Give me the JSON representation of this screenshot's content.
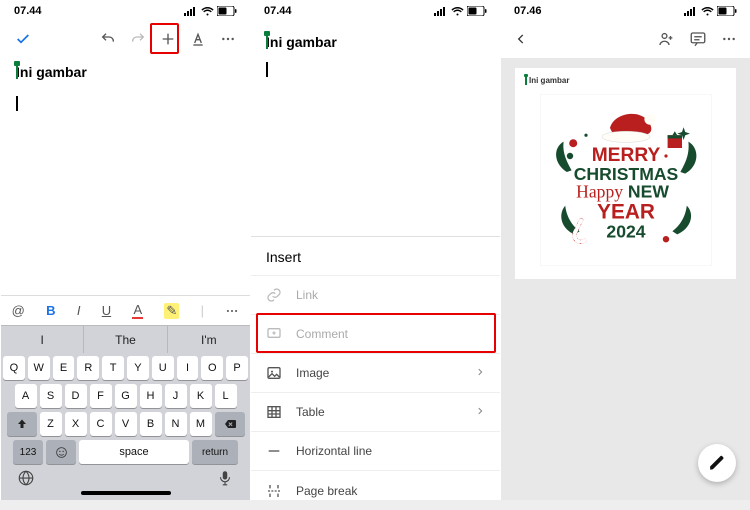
{
  "panel1": {
    "status": {
      "time": "07.44"
    },
    "doc_title": "Ini gambar",
    "keyboard": {
      "suggestions": [
        "I",
        "The",
        "I'm"
      ],
      "row1": [
        "Q",
        "W",
        "E",
        "R",
        "T",
        "Y",
        "U",
        "I",
        "O",
        "P"
      ],
      "row2": [
        "A",
        "S",
        "D",
        "F",
        "G",
        "H",
        "J",
        "K",
        "L"
      ],
      "row3": [
        "Z",
        "X",
        "C",
        "V",
        "B",
        "N",
        "M"
      ],
      "numkey": "123",
      "space": "space",
      "return": "return"
    },
    "format": {
      "b": "B",
      "i": "I",
      "u": "U",
      "a": "A"
    }
  },
  "panel2": {
    "status": {
      "time": "07.44"
    },
    "doc_title": "Ini gambar",
    "sheet": {
      "title": "Insert",
      "rows": [
        {
          "icon": "link",
          "label": "Link",
          "disabled": true
        },
        {
          "icon": "comment",
          "label": "Comment",
          "disabled": true
        },
        {
          "icon": "image",
          "label": "Image",
          "chevron": true
        },
        {
          "icon": "table",
          "label": "Table",
          "chevron": true
        },
        {
          "icon": "hr",
          "label": "Horizontal line"
        },
        {
          "icon": "pagebreak",
          "label": "Page break"
        }
      ]
    }
  },
  "panel3": {
    "status": {
      "time": "07.46"
    },
    "mini_title": "Ini gambar",
    "art": {
      "line1": "MERRY",
      "line2": "CHRISTMAS",
      "line3": "Happy NEW",
      "line4": "YEAR",
      "line5": "2024"
    }
  }
}
